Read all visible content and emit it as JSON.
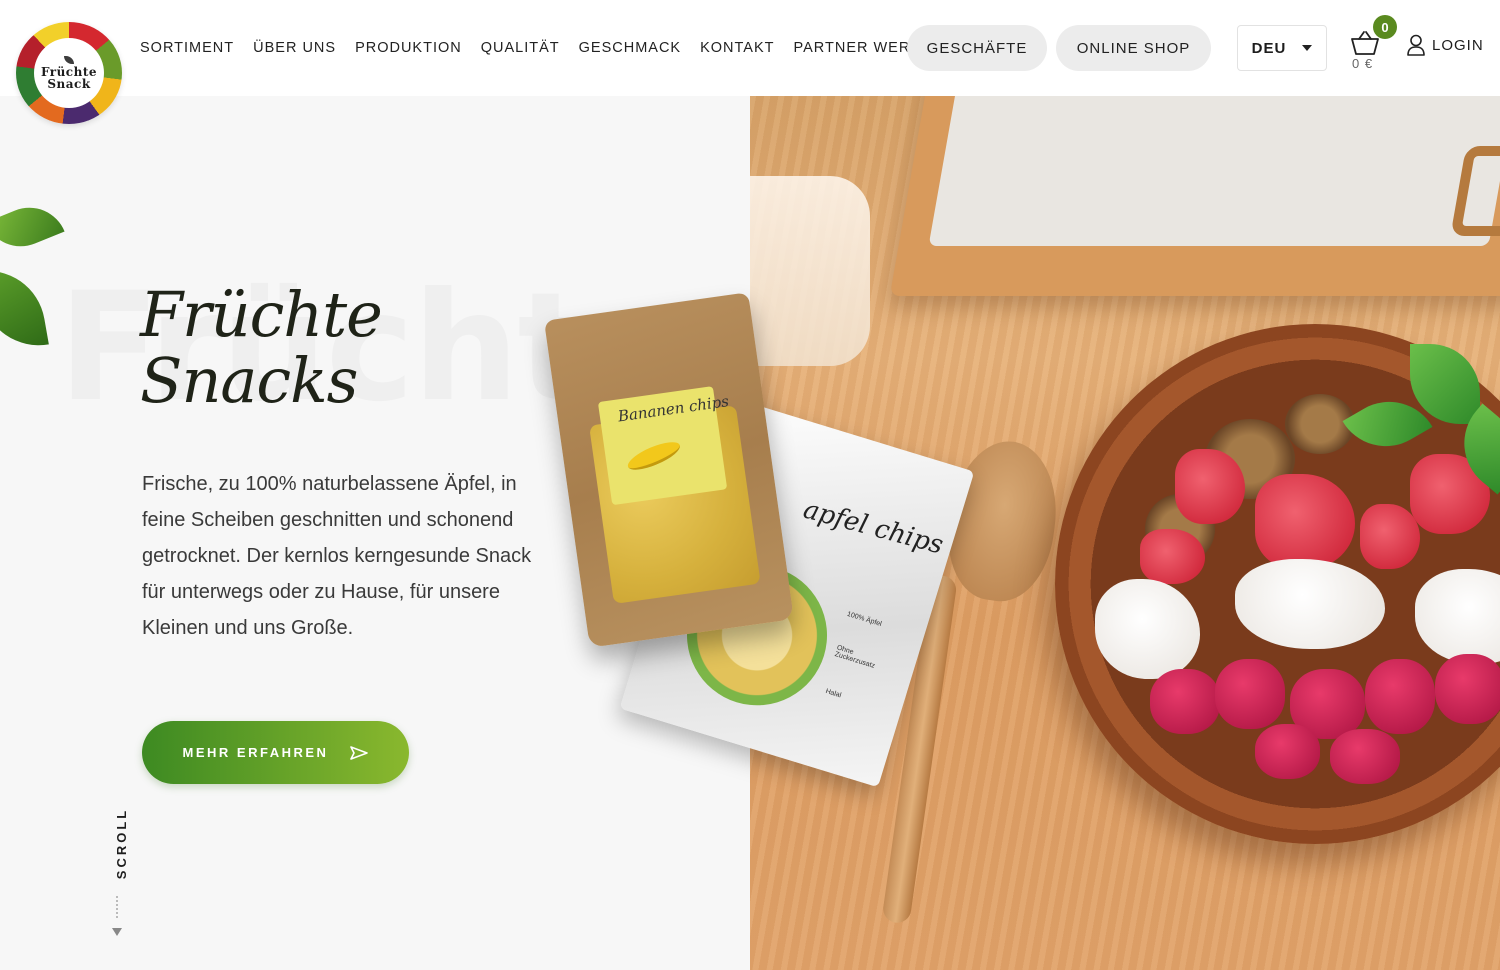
{
  "brand": {
    "logo_line1": "Früchte",
    "logo_line2": "Snack"
  },
  "nav": {
    "items": [
      {
        "label": "SORTIMENT"
      },
      {
        "label": "ÜBER UNS"
      },
      {
        "label": "PRODUKTION"
      },
      {
        "label": "QUALITÄT"
      },
      {
        "label": "GESCHMACK"
      },
      {
        "label": "KONTAKT"
      },
      {
        "label": "PARTNER WERDEN"
      }
    ],
    "stores_button": "GESCHÄFTE",
    "shop_button": "ONLINE SHOP",
    "language": "DEU",
    "cart_count": "0",
    "cart_total": "0 €",
    "login": "LOGIN"
  },
  "hero": {
    "background_word": "Früchte",
    "title_line1": "Früchte",
    "title_line2": "Snacks",
    "description": "Frische, zu 100% naturbelassene Äpfel, in feine Scheiben geschnitten und schonend getrocknet. Der kernlos kerngesunde Snack für unterwegs oder zu Hause, für unsere Kleinen und uns Große.",
    "cta_label": "MEHR ERFAHREN",
    "scroll_label": "SCROLL"
  },
  "products": {
    "banana_pack_title": "Bananen chips",
    "apple_pack_title": "apfel chips",
    "apple_pack_note1": "100% Äpfel",
    "apple_pack_note2": "Ohne Zuckerzusatz",
    "apple_pack_note3": "Halal"
  },
  "colors": {
    "accent_green": "#5a8a1f",
    "cta_start": "#3d8a22",
    "cta_end": "#8ab82e"
  }
}
